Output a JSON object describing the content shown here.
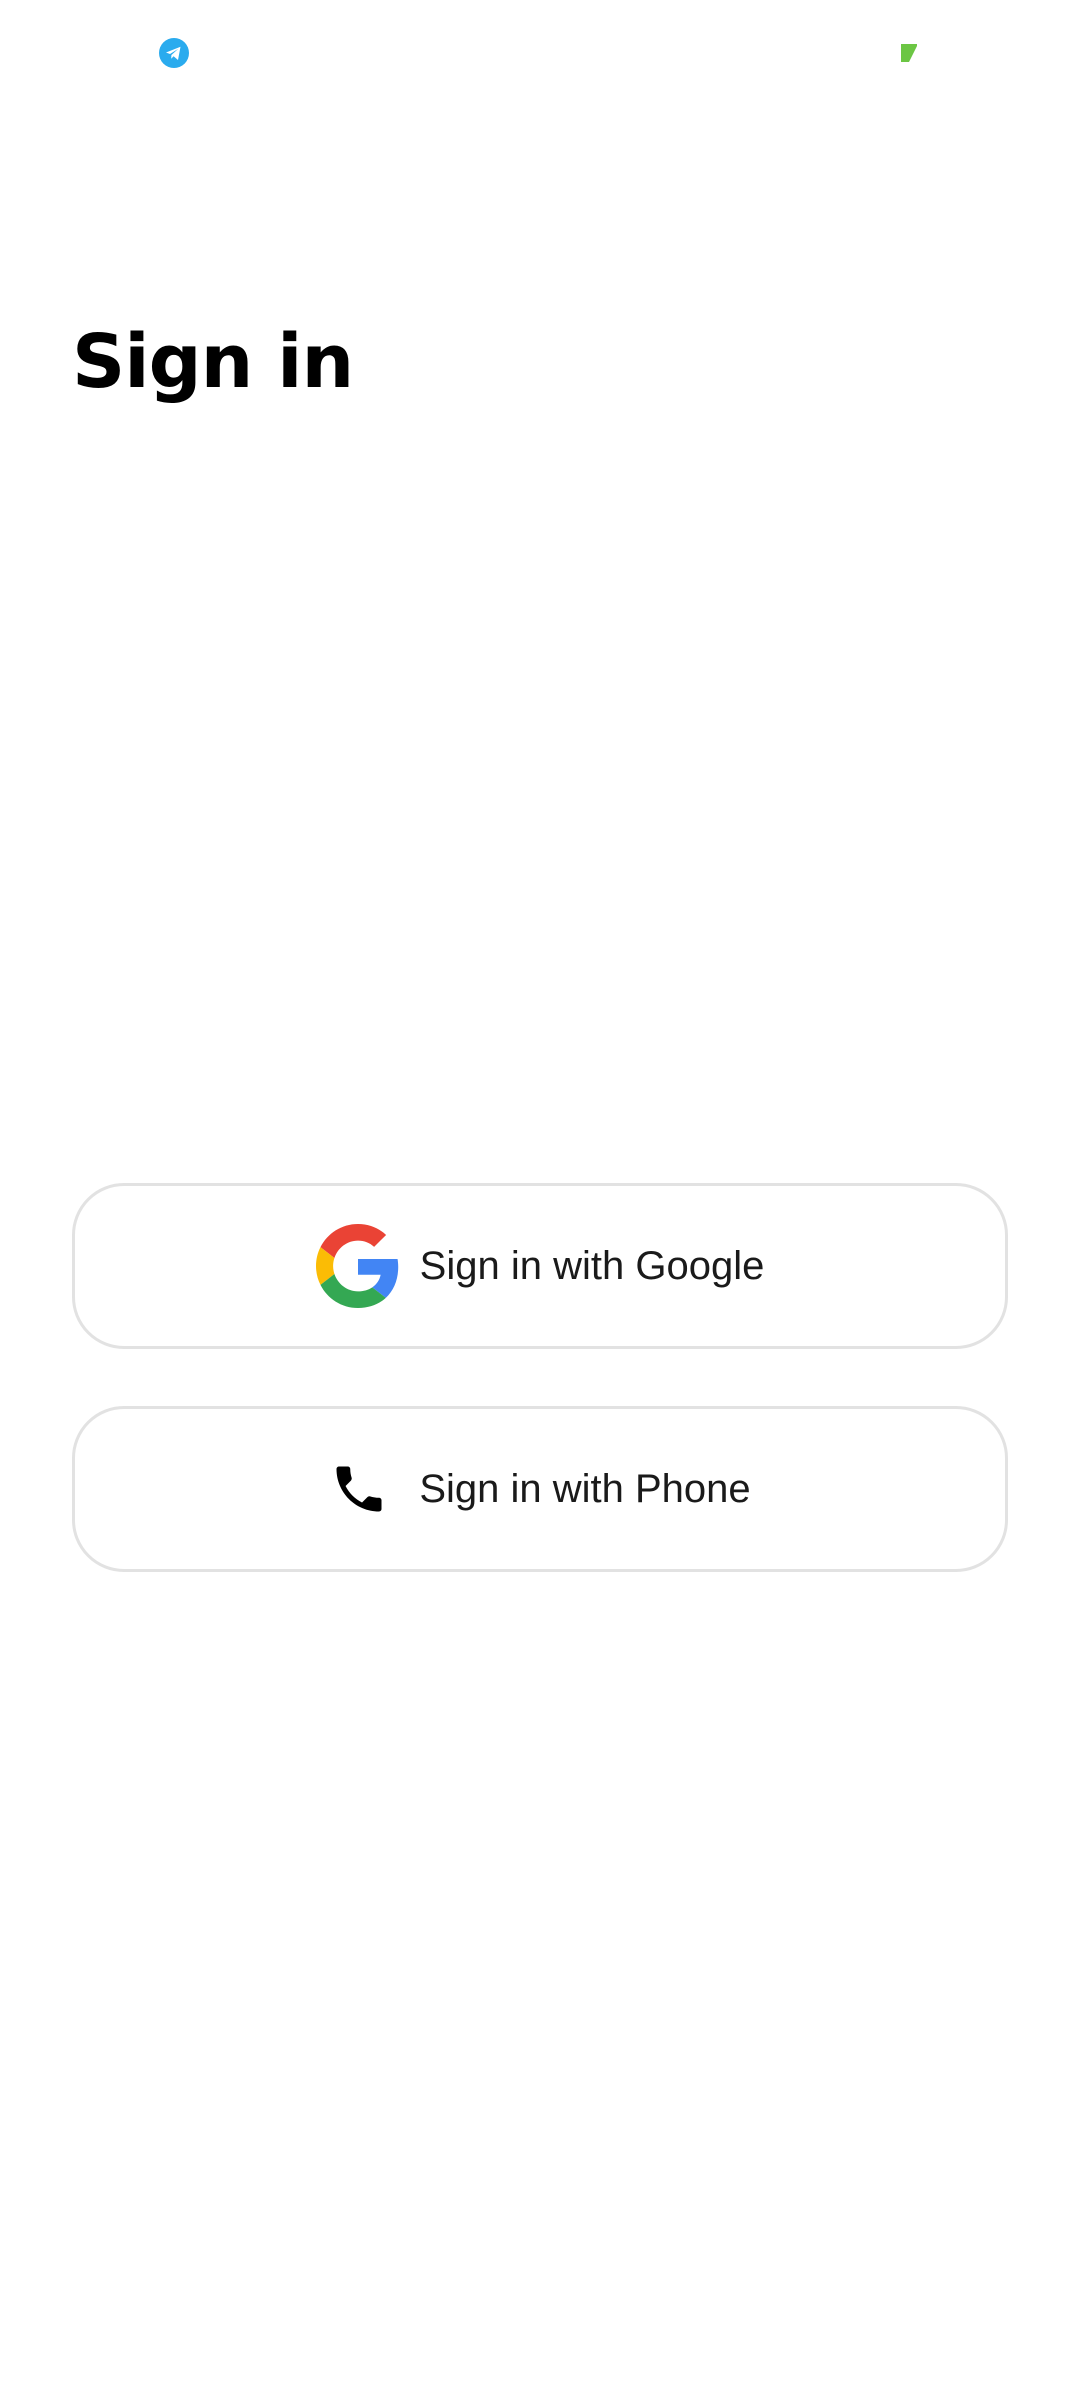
{
  "status_bar": {
    "left_icon": "telegram-icon",
    "right_icon": "battery-icon",
    "colors": {
      "telegram": "#2AABEE",
      "battery": "#6CC644"
    }
  },
  "page": {
    "title": "Sign in"
  },
  "buttons": {
    "google": {
      "label": "Sign in with Google",
      "icon": "google-g-icon"
    },
    "phone": {
      "label": "Sign in with Phone",
      "icon": "phone-icon"
    }
  },
  "colors": {
    "background": "#FFFFFF",
    "button_border": "#E2E2E2",
    "title_text": "#000000"
  }
}
